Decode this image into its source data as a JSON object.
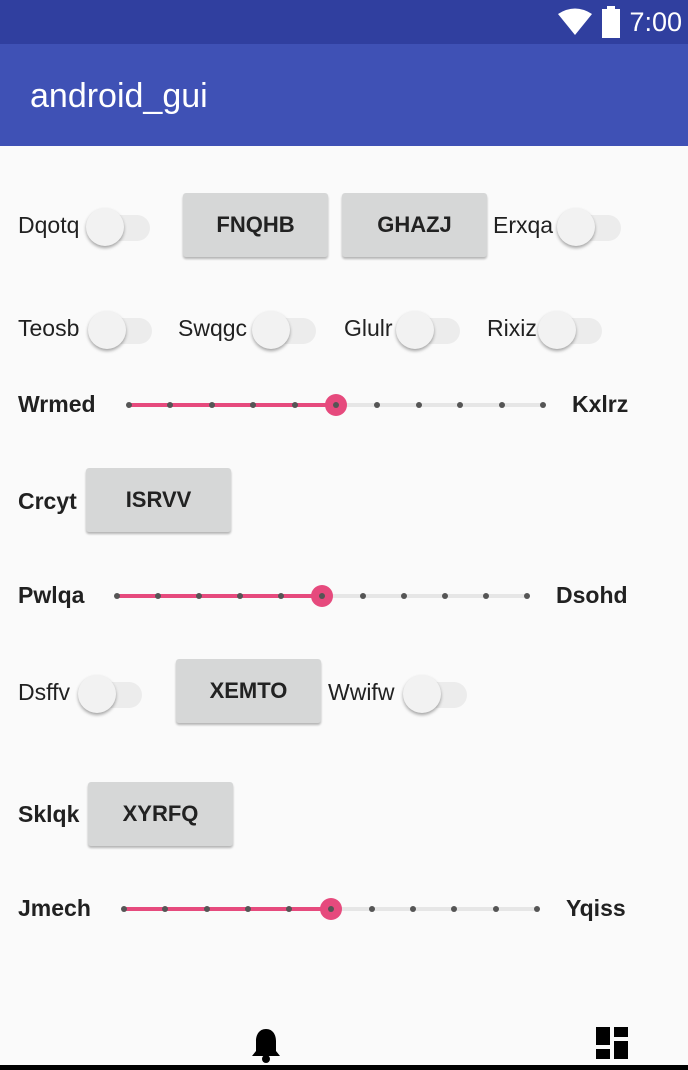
{
  "status": {
    "time": "7:00"
  },
  "app": {
    "title": "android_gui"
  },
  "row1": {
    "label_a": "Dqotq",
    "switch_a_on": false,
    "button_1": "FNQHB",
    "button_2": "GHAZJ",
    "label_b": "Erxqa",
    "switch_b_on": false
  },
  "row2": [
    {
      "label": "Teosb",
      "on": false
    },
    {
      "label": "Swqgc",
      "on": false
    },
    {
      "label": "Glulr",
      "on": false
    },
    {
      "label": "Rixiz",
      "on": false
    }
  ],
  "seekbar1": {
    "left_label": "Wrmed",
    "right_label": "Kxlrz",
    "steps": 10,
    "value": 5
  },
  "row4": {
    "label": "Crcyt",
    "button": "ISRVV"
  },
  "seekbar2": {
    "left_label": "Pwlqa",
    "right_label": "Dsohd",
    "steps": 10,
    "value": 5
  },
  "row6": {
    "label_a": "Dsffv",
    "switch_a_on": false,
    "button": "XEMTO",
    "label_b": "Wwifw",
    "switch_b_on": false
  },
  "row7": {
    "label": "Sklqk",
    "button": "XYRFQ"
  },
  "seekbar3": {
    "left_label": "Jmech",
    "right_label": "Yqiss",
    "steps": 10,
    "value": 5
  },
  "nav": {
    "icons": [
      "bell-icon",
      "dashboard-icon"
    ]
  },
  "colors": {
    "status_bar": "#303f9f",
    "app_bar": "#3f51b5",
    "accent": "#e64a7d",
    "button": "#d6d7d7"
  }
}
